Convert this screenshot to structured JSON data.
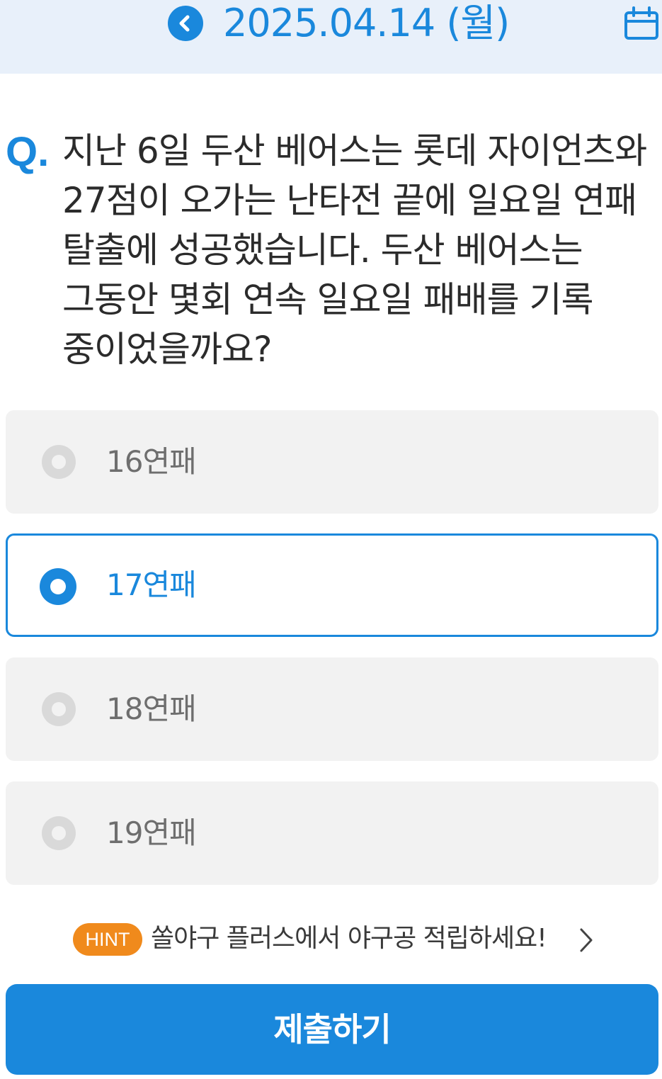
{
  "header": {
    "date": "2025.04.14 (월)",
    "prev_icon": "chevron-left-icon",
    "calendar_icon": "calendar-icon"
  },
  "question": {
    "prefix": "Q.",
    "text": "지난 6일 두산 베어스는 롯데 자이언츠와 27점이 오가는 난타전 끝에 일요일 연패 탈출에 성공했습니다. 두산 베어스는 그동안 몇회 연속 일요일 패배를 기록 중이었을까요?"
  },
  "options": [
    {
      "label": "16연패",
      "selected": false
    },
    {
      "label": "17연패",
      "selected": true
    },
    {
      "label": "18연패",
      "selected": false
    },
    {
      "label": "19연패",
      "selected": false
    }
  ],
  "hint": {
    "badge": "HINT",
    "text": "쏠야구 플러스에서 야구공 적립하세요!",
    "chevron_icon": "chevron-right-icon"
  },
  "submit": {
    "label": "제출하기"
  },
  "colors": {
    "accent": "#1a88dc",
    "header_bg": "#e8f0fa",
    "option_bg": "#f2f2f2",
    "hint_badge": "#f08a1c"
  }
}
